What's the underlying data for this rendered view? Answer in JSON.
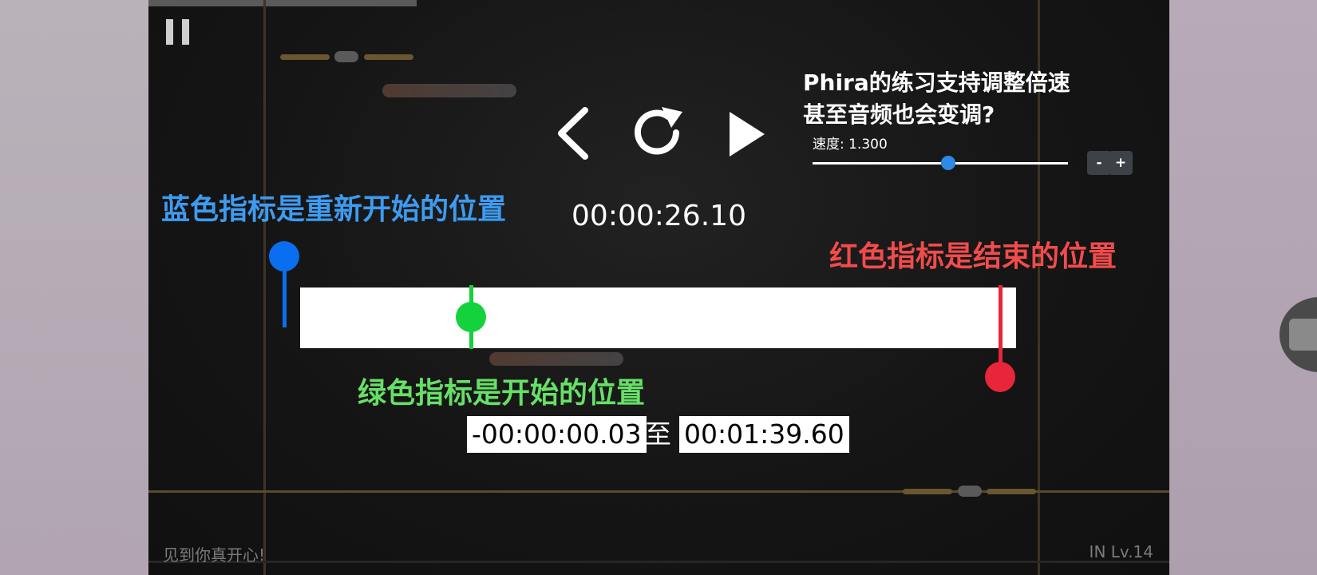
{
  "practice": {
    "title_line1": "Phira的练习支持调整倍速",
    "title_line2": "甚至音频也会变调?",
    "speed_label": "速度: 1.300",
    "speed": 1.3,
    "speed_fraction": 0.53,
    "minus_label": "-",
    "plus_label": "+",
    "current_time": "00:00:26.10",
    "annotations": {
      "blue": "蓝色指标是重新开始的位置",
      "red": "红色指标是结束的位置",
      "green": "绿色指标是开始的位置"
    },
    "markers": {
      "restart_fraction": 0.0,
      "start_fraction": 0.261,
      "end_fraction": 1.0
    },
    "range": {
      "start": "-00:00:00.03",
      "separator": "至",
      "end": "00:01:39.60"
    },
    "colors": {
      "blue_marker": "#0a6ef0",
      "green_marker": "#14d23c",
      "red_marker": "#e8253a",
      "speed_knob": "#2c8ae8"
    }
  },
  "footer": {
    "greeting": "见到你真开心!",
    "level": "IN Lv.14"
  },
  "icons": {
    "pause": "pause-icon",
    "back": "chevron-left-icon",
    "restart": "restart-icon",
    "play": "play-icon"
  }
}
